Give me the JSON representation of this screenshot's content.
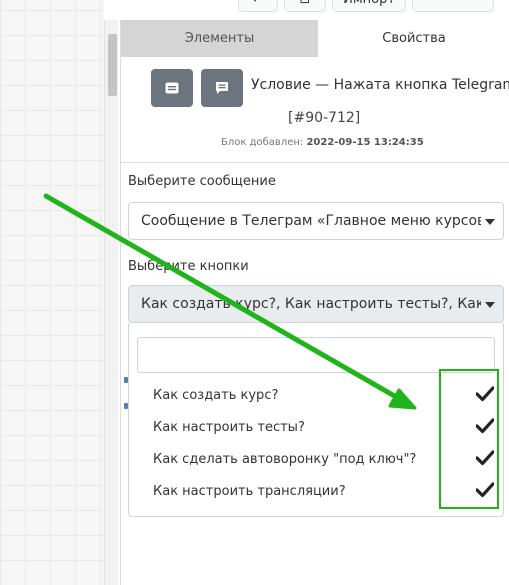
{
  "toolbar": {
    "btn1": "←",
    "btn2": "⊡",
    "import_label": "Импорт",
    "btn4": ""
  },
  "tabs": {
    "elements": "Элементы",
    "properties": "Свойства"
  },
  "block": {
    "title": "Условие — Нажата кнопка Telegram",
    "id": "[#90-712]",
    "added_label": "Блок добавлен:",
    "added_value": "2022-09-15 13:24:35"
  },
  "message": {
    "label": "Выберите сообщение",
    "value": "Сообщение в Телеграм «Главное меню курсов: В"
  },
  "buttons": {
    "label": "Выберите кнопки",
    "value": "Как создать курс?, Как настроить тесты?, Как сде",
    "search_placeholder": "",
    "items": [
      "Как создать курс?",
      "Как настроить тесты?",
      "Как сделать автоворонку \"под ключ\"?",
      "Как настроить трансляции?"
    ]
  },
  "colors": {
    "accent_green": "#1fb51a",
    "icon_button": "#6c757d",
    "inactive_tab": "#d5d5d5"
  },
  "icons": {
    "block_icon_1": "message-square-icon",
    "block_icon_2": "comment-icon",
    "check": "check-icon"
  }
}
